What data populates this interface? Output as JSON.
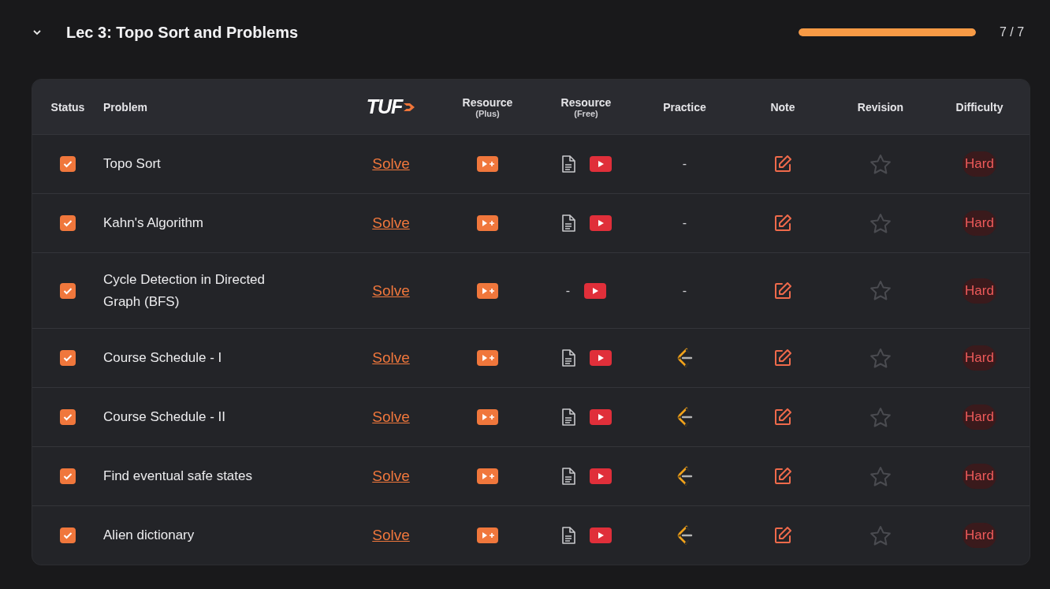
{
  "section": {
    "expanded": true,
    "title": "Lec 3: Topo Sort and Problems",
    "progress": {
      "level": 1,
      "reading": "7 / 7"
    }
  },
  "table": {
    "columns": {
      "status": "Status",
      "problem": "Problem",
      "logo": "TUF",
      "plus": {
        "title": "Resource",
        "sub": "(Plus)"
      },
      "free": {
        "title": "Resource",
        "sub": "(Free)"
      },
      "practice": "Practice",
      "note": "Note",
      "revision": "Revision",
      "difficulty": "Difficulty"
    },
    "rows": [
      {
        "checked": true,
        "problem": "Topo Sort",
        "solve": "Solve",
        "article": {
          "kind": "icon"
        },
        "practice": {
          "kind": "dash",
          "text": "-"
        },
        "starred": false,
        "difficulty": "Hard"
      },
      {
        "checked": true,
        "problem": "Kahn's Algorithm",
        "solve": "Solve",
        "article": {
          "kind": "icon"
        },
        "practice": {
          "kind": "dash",
          "text": "-"
        },
        "starred": false,
        "difficulty": "Hard"
      },
      {
        "checked": true,
        "problem": "Cycle Detection in Directed Graph (BFS)",
        "solve": "Solve",
        "article": {
          "kind": "dash",
          "text": "-"
        },
        "practice": {
          "kind": "dash",
          "text": "-"
        },
        "starred": false,
        "difficulty": "Hard"
      },
      {
        "checked": true,
        "problem": "Course Schedule - I",
        "solve": "Solve",
        "article": {
          "kind": "icon"
        },
        "practice": {
          "kind": "icon"
        },
        "starred": false,
        "difficulty": "Hard"
      },
      {
        "checked": true,
        "problem": "Course Schedule - II",
        "solve": "Solve",
        "article": {
          "kind": "icon"
        },
        "practice": {
          "kind": "icon"
        },
        "starred": false,
        "difficulty": "Hard"
      },
      {
        "checked": true,
        "problem": "Find eventual safe states",
        "solve": "Solve",
        "article": {
          "kind": "icon"
        },
        "practice": {
          "kind": "icon"
        },
        "starred": false,
        "difficulty": "Hard"
      },
      {
        "checked": true,
        "problem": "Alien dictionary",
        "solve": "Solve",
        "article": {
          "kind": "icon"
        },
        "practice": {
          "kind": "icon"
        },
        "starred": false,
        "difficulty": "Hard"
      }
    ]
  }
}
